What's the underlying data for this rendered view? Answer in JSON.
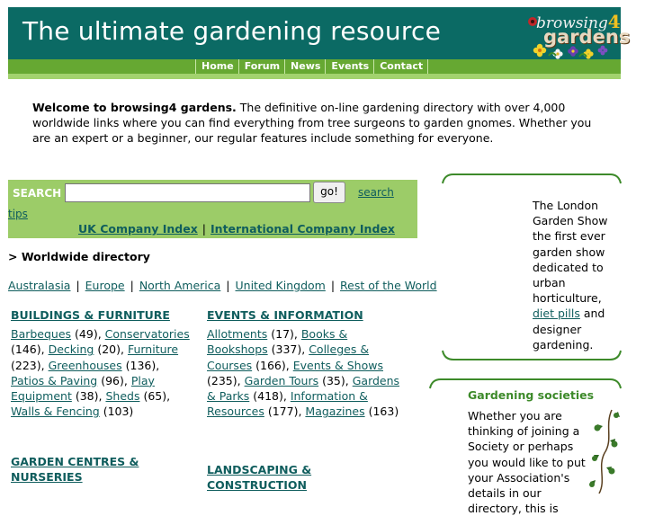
{
  "header": {
    "title": "The ultimate gardening resource",
    "logo_line1": "browsing",
    "logo_four": "4",
    "logo_line2": "gardens"
  },
  "nav": [
    "Home",
    "Forum",
    "News",
    "Events",
    "Contact"
  ],
  "welcome": {
    "bold": "Welcome to browsing4 gardens.",
    "text": " The definitive on-line gardening directory with over 4,000 worldwide links where you can find everything from tree surgeons to garden gnomes. Whether you are an expert or a beginner, our regular features include something for everyone."
  },
  "search": {
    "label": "SEARCH",
    "value": "",
    "button": "go!",
    "tips_part1": "search",
    "tips_part2": "tips",
    "uk_index": "UK Company Index",
    "index_sep": "|",
    "intl_index": "International Company Index"
  },
  "directory": {
    "crumb": "> Worldwide directory",
    "regions": [
      "Australasia",
      "Europe",
      "North America",
      "United Kingdom",
      "Rest of the World"
    ],
    "region_sep": "|"
  },
  "categories": [
    {
      "title": "BUILDINGS & FURNITURE",
      "items": [
        {
          "name": "Barbeques",
          "count": "(49)"
        },
        {
          "name": "Conservatories",
          "count": "(146)"
        },
        {
          "name": "Decking",
          "count": "(20)"
        },
        {
          "name": "Furniture",
          "count": "(223)"
        },
        {
          "name": "Greenhouses",
          "count": "(136)"
        },
        {
          "name": "Patios & Paving",
          "count": "(96)"
        },
        {
          "name": "Play Equipment",
          "count": "(38)"
        },
        {
          "name": "Sheds",
          "count": "(65)"
        },
        {
          "name": "Walls & Fencing",
          "count": "(103)"
        }
      ]
    },
    {
      "title": "EVENTS & INFORMATION",
      "items": [
        {
          "name": "Allotments",
          "count": "(17)"
        },
        {
          "name": "Books & Bookshops",
          "count": "(337)"
        },
        {
          "name": "Colleges & Courses",
          "count": "(166)"
        },
        {
          "name": "Events & Shows",
          "count": "(235)"
        },
        {
          "name": "Garden Tours",
          "count": "(35)"
        },
        {
          "name": "Gardens & Parks",
          "count": "(418)"
        },
        {
          "name": "Information & Resources",
          "count": "(177)"
        },
        {
          "name": "Magazines",
          "count": "(163)"
        }
      ]
    },
    {
      "title": "GARDEN CENTRES & NURSERIES",
      "items": []
    },
    {
      "title": "LANDSCAPING & CONSTRUCTION",
      "items": []
    }
  ],
  "promo": {
    "text_before": "The London Garden Show the first ever garden show dedicated to urban horticulture, ",
    "link": "diet pills",
    "text_after": " and designer gardening."
  },
  "societies": {
    "title": "Gardening societies",
    "text": "Whether you are thinking of joining a Society or perhaps you would like to put your Association's details in our directory, this is"
  },
  "colors": {
    "header_bg": "#0b6a64",
    "nav_bg": "#66a832",
    "search_bg": "#9ccc68",
    "link": "#0f5d5d",
    "society_title": "#3d8a2a"
  }
}
